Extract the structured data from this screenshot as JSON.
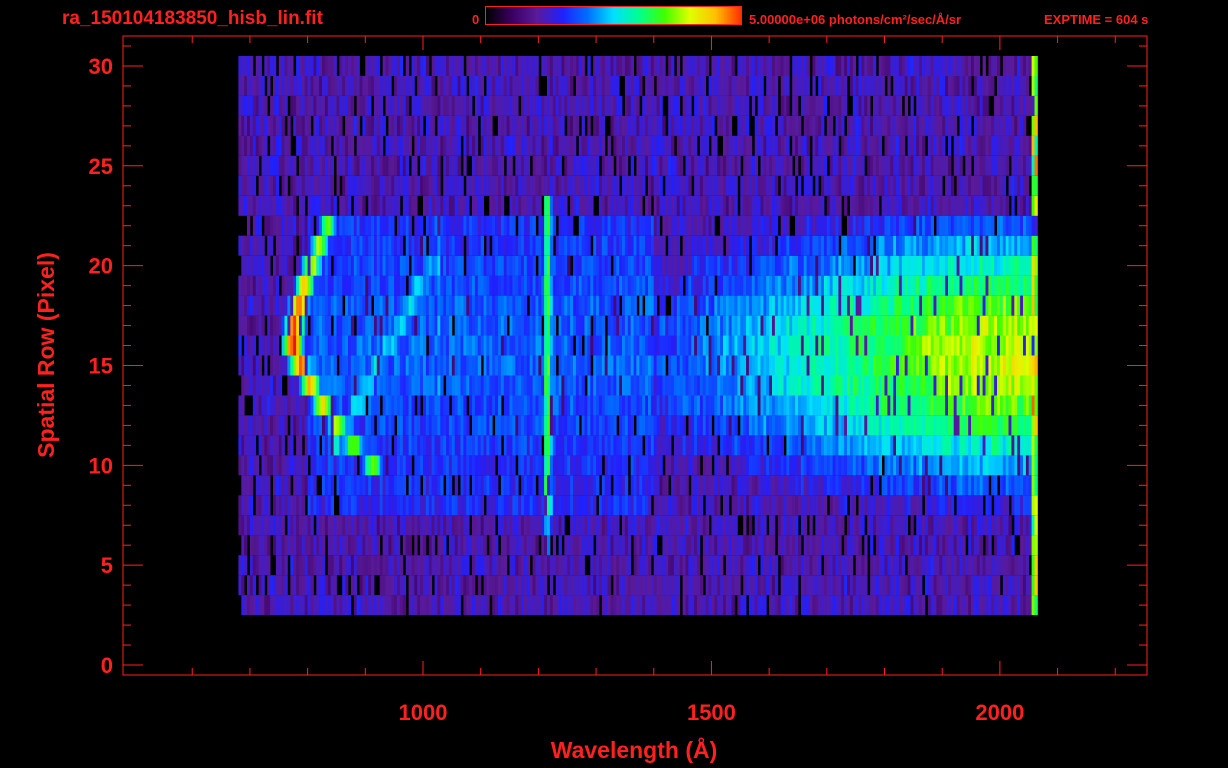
{
  "header": {
    "title": "ra_150104183850_hisb_lin.fit",
    "colorbar_min_label": "0",
    "colorbar_max_label": "5.00000e+06 photons/cm²/sec/Å/sr",
    "exptime_label": "EXPTIME = 604 s"
  },
  "colors": {
    "text": "#ff2020",
    "background": "#000000",
    "colormap": [
      "#000000",
      "#3a0060",
      "#5a1a9a",
      "#2020ff",
      "#0070ff",
      "#00e0ff",
      "#00ff90",
      "#40ff00",
      "#e0ff00",
      "#ffc000",
      "#ff3000",
      "#d00000"
    ]
  },
  "chart_data": {
    "type": "heatmap",
    "title": "ra_150104183850_hisb_lin.fit",
    "xlabel": "Wavelength (Å)",
    "ylabel": "Spatial Row (Pixel)",
    "xlim": [
      480,
      2255
    ],
    "ylim": [
      -0.5,
      31.5
    ],
    "x_ticks": [
      1000,
      1500,
      2000
    ],
    "y_ticks": [
      0,
      5,
      10,
      15,
      20,
      25,
      30
    ],
    "colorbar": {
      "min": 0,
      "max": 5000000,
      "units": "photons/cm²/sec/Å/sr"
    },
    "exptime_s": 604,
    "data_extent": {
      "x": [
        680,
        2065
      ],
      "rows": [
        3,
        30
      ]
    },
    "features": [
      {
        "name": "curved-bright-arc",
        "x_range": [
          770,
          900
        ],
        "rows": [
          10,
          22
        ],
        "level": "high"
      },
      {
        "name": "vertical-emission-line",
        "x": 1216,
        "rows": [
          6,
          23
        ],
        "level": "medium-high"
      },
      {
        "name": "faint-line",
        "x": 1026,
        "rows": [
          13,
          22
        ],
        "level": "medium"
      },
      {
        "name": "broad-continuum",
        "x_range": [
          1650,
          2065
        ],
        "rows": [
          8,
          22
        ],
        "level": "medium-high"
      },
      {
        "name": "band-edge",
        "x": 2060,
        "rows": [
          3,
          30
        ],
        "level": "high"
      }
    ]
  }
}
